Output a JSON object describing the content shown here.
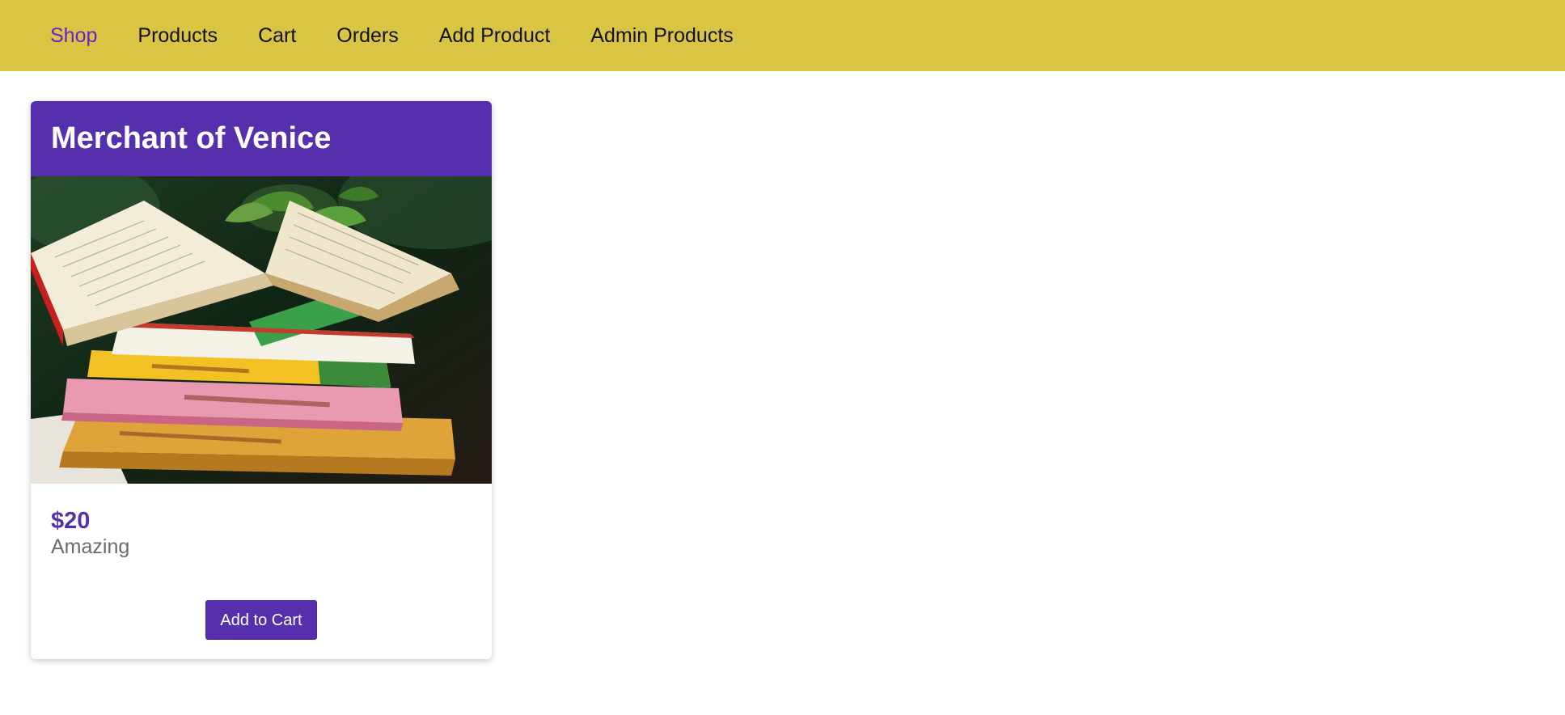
{
  "nav": {
    "items": [
      {
        "label": "Shop",
        "active": true
      },
      {
        "label": "Products"
      },
      {
        "label": "Cart"
      },
      {
        "label": "Orders"
      },
      {
        "label": "Add Product"
      },
      {
        "label": "Admin Products"
      }
    ]
  },
  "product": {
    "title": "Merchant of Venice",
    "price": "$20",
    "description": "Amazing",
    "button_label": "Add to Cart",
    "image_icon": "book-stack-image"
  },
  "colors": {
    "header_bg": "#dac443",
    "accent": "#5630ac",
    "active_nav": "#6a1fd1"
  }
}
